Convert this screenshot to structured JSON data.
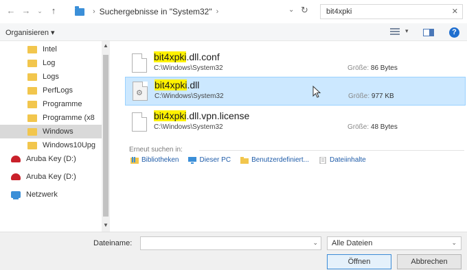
{
  "address": {
    "back_icon": "arrow-left-icon",
    "forward_icon": "arrow-right-icon",
    "recent_icon": "chevron-down-icon",
    "up_icon": "arrow-up-icon",
    "breadcrumb": "Suchergebnisse in \"System32\"",
    "search_value": "bit4xpki"
  },
  "toolbar": {
    "organize_label": "Organisieren ▾"
  },
  "nav": {
    "items": [
      {
        "label": "Intel",
        "icon": "folder-icon"
      },
      {
        "label": "Log",
        "icon": "folder-icon"
      },
      {
        "label": "Logs",
        "icon": "folder-icon"
      },
      {
        "label": "PerfLogs",
        "icon": "folder-icon"
      },
      {
        "label": "Programme",
        "icon": "folder-icon"
      },
      {
        "label": "Programme (x8",
        "icon": "folder-icon"
      },
      {
        "label": "Windows",
        "icon": "folder-icon",
        "selected": true
      },
      {
        "label": "Windows10Upg",
        "icon": "folder-icon"
      },
      {
        "label": "Aruba Key (D:)",
        "icon": "usb-drive-icon"
      },
      {
        "label": "Aruba Key (D:)",
        "icon": "usb-drive-icon"
      },
      {
        "label": "Netzwerk",
        "icon": "network-icon"
      }
    ]
  },
  "results": [
    {
      "name_highlight": "bit4xpki",
      "name_rest": ".dll.conf",
      "path": "C:\\Windows\\System32",
      "size_label": "Größe:",
      "size_value": "86 Bytes"
    },
    {
      "name_highlight": "bit4xpki",
      "name_rest": ".dll",
      "path": "C:\\Windows\\System32",
      "size_label": "Größe:",
      "size_value": "977 KB",
      "selected": true
    },
    {
      "name_highlight": "bit4xpki",
      "name_rest": ".dll.vpn.license",
      "path": "C:\\Windows\\System32",
      "size_label": "Größe:",
      "size_value": "48 Bytes"
    }
  ],
  "research": {
    "label": "Erneut suchen in:",
    "links": [
      "Bibliotheken",
      "Dieser PC",
      "Benutzerdefiniert...",
      "Dateiinhalte"
    ]
  },
  "bottom": {
    "filename_label": "Dateiname:",
    "filename_value": "",
    "filter_value": "Alle Dateien",
    "open_label": "Öffnen",
    "cancel_label": "Abbrechen"
  },
  "colors": {
    "highlight": "#fff200",
    "selection": "#cce8ff",
    "link": "#1e5ba8"
  }
}
